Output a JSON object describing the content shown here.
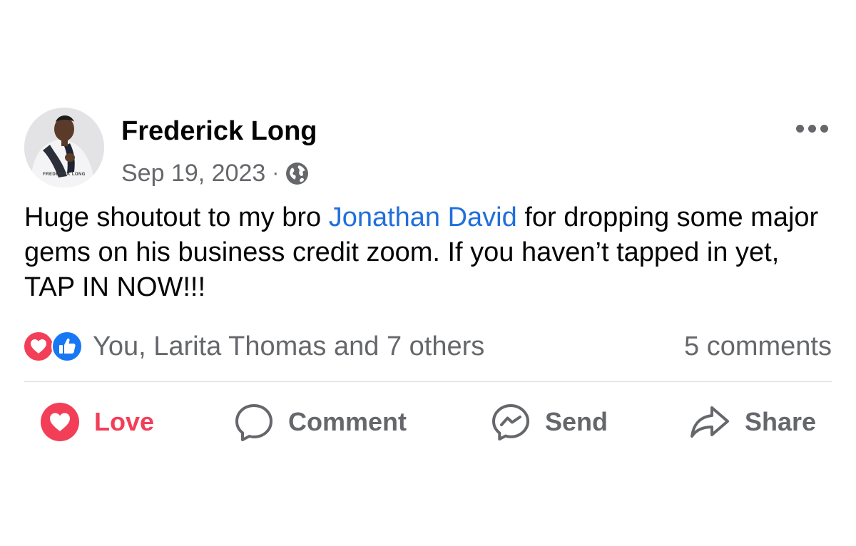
{
  "post": {
    "author": "Frederick Long",
    "avatar_caption": "FREDERICK LONG",
    "date": "Sep 19, 2023",
    "separator": "·",
    "privacy_icon": "globe-icon",
    "more_icon": "more-options-icon",
    "text_before_mention": "Huge shoutout to my bro ",
    "mention": "Jonathan David",
    "text_after_mention": " for dropping some major gems on his business credit zoom.  If you haven’t tapped in yet, TAP IN NOW!!!"
  },
  "reactions": {
    "icons": [
      "love-reaction-icon",
      "like-reaction-icon"
    ],
    "summary": "You, Larita Thomas and 7 others",
    "comments": "5 comments"
  },
  "actions": {
    "love": "Love",
    "comment": "Comment",
    "send": "Send",
    "share": "Share"
  },
  "colors": {
    "love": "#f33e58",
    "like": "#1877f2",
    "mention": "#216fdb",
    "muted": "#65676b",
    "text": "#050505"
  }
}
